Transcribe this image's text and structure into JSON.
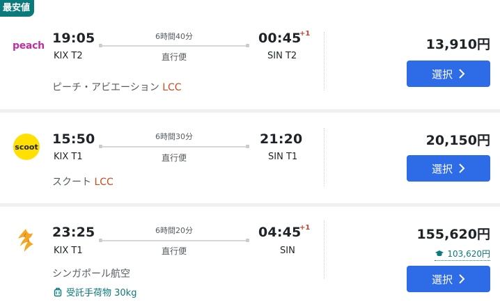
{
  "badge": "最安値",
  "flights": [
    {
      "logo_text": "peach",
      "dep_time": "19:05",
      "dep_code": "KIX T2",
      "duration": "6時間40分",
      "stops": "直行便",
      "arr_time": "00:45",
      "next_day": "+1",
      "arr_code": "SIN T2",
      "airline": "ピーチ・アビエーション",
      "lcc": "LCC",
      "price": "13,910円",
      "select_label": "選択"
    },
    {
      "logo_text": "scoot",
      "dep_time": "15:50",
      "dep_code": "KIX T1",
      "duration": "6時間30分",
      "stops": "直行便",
      "arr_time": "21:20",
      "next_day": "",
      "arr_code": "SIN T1",
      "airline": "スクート",
      "lcc": "LCC",
      "price": "20,150円",
      "select_label": "選択"
    },
    {
      "logo_text": "",
      "dep_time": "23:25",
      "dep_code": "KIX T1",
      "duration": "6時間20分",
      "stops": "直行便",
      "arr_time": "04:45",
      "next_day": "+1",
      "arr_code": "SIN",
      "airline": "シンガポール航空",
      "lcc": "",
      "price": "155,620円",
      "sub_price": "103,620円",
      "baggage": "受託手荷物 30kg",
      "select_label": "選択"
    }
  ],
  "colors": {
    "accent": "#2e6be6",
    "badge": "#0a7a7a",
    "lcc": "#c84a1e",
    "peach": "#c02ea0",
    "scoot": "#ffe000",
    "singapore": "#f5a623"
  }
}
